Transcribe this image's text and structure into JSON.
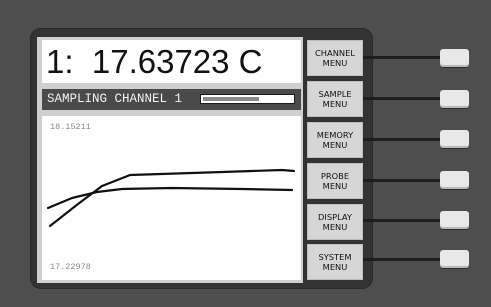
{
  "display": {
    "reading": "1:  17.63723 C",
    "status_label": "SAMPLING CHANNEL 1",
    "progress_fraction": 0.63,
    "graph": {
      "y_max_label": "18.15211",
      "y_min_label": "17.22978"
    }
  },
  "menu": [
    {
      "line1": "CHANNEL",
      "line2": "MENU"
    },
    {
      "line1": "SAMPLE",
      "line2": "MENU"
    },
    {
      "line1": "MEMORY",
      "line2": "MENU"
    },
    {
      "line1": "PROBE",
      "line2": "MENU"
    },
    {
      "line1": "DISPLAY",
      "line2": "MENU"
    },
    {
      "line1": "SYSTEM",
      "line2": "MENU"
    }
  ],
  "colors": {
    "panel": "#4e4e4e",
    "bezel": "#333333",
    "status_bar": "#4a4a4a",
    "button": "#d6d6d6",
    "softkey": "#e8e8e8"
  }
}
